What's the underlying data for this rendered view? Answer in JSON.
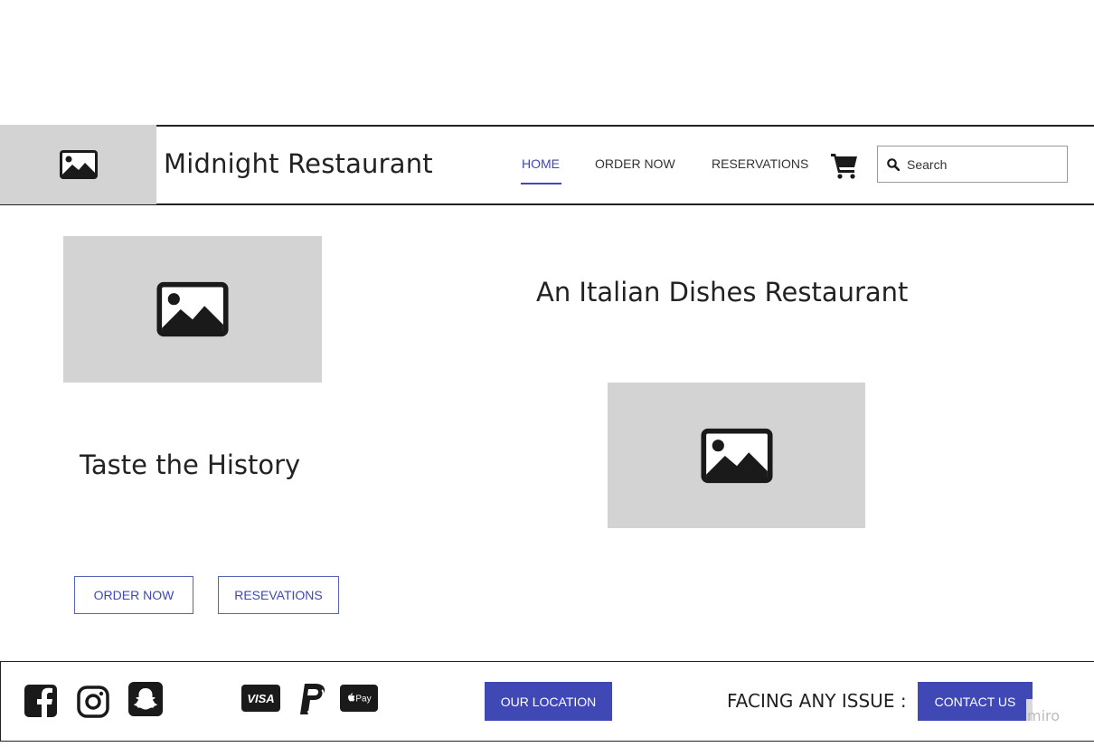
{
  "header": {
    "brand": "Midnight Restaurant",
    "nav": [
      {
        "label": "HOME",
        "active": true
      },
      {
        "label": "ORDER NOW",
        "active": false
      },
      {
        "label": "RESERVATIONS",
        "active": false
      }
    ],
    "search_placeholder": "Search",
    "logo_icon": "image-placeholder-icon",
    "cart_icon": "cart-icon",
    "search_icon": "search-icon"
  },
  "main": {
    "heading_right": "An Italian Dishes Restaurant",
    "heading_left": "Taste the History",
    "buttons": {
      "order_now": "ORDER NOW",
      "reservations": "RESEVATIONS"
    }
  },
  "footer": {
    "social_icons": [
      "facebook-icon",
      "instagram-icon",
      "snapchat-icon"
    ],
    "payment_icons": [
      "visa-icon",
      "paypal-icon",
      "apple-pay-icon"
    ],
    "visa_text": "VISA",
    "applepay_text": "Pay",
    "location_button": "OUR LOCATION",
    "issue_text": "FACING ANY ISSUE :",
    "contact_button": "CONTACT US",
    "watermark": "miro"
  },
  "colors": {
    "accent": "#3f48b5",
    "placeholder": "#d3d3d3",
    "text": "#222222"
  }
}
